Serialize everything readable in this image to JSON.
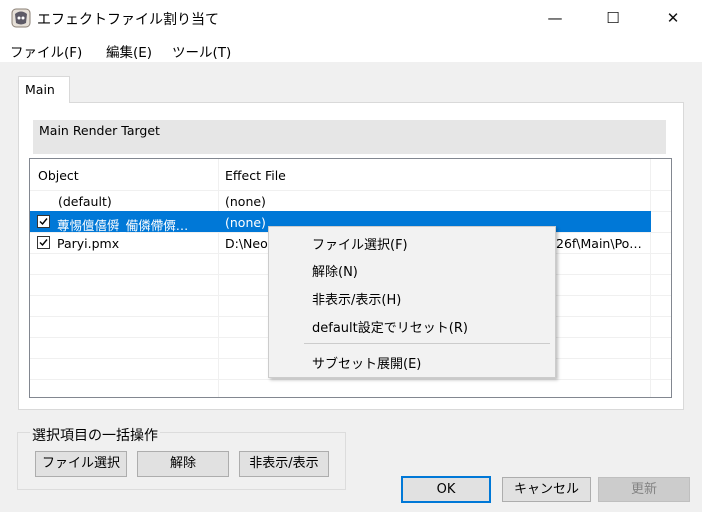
{
  "window": {
    "title": "エフェクトファイル割り当て",
    "minimize_glyph": "—",
    "maximize_glyph": "☐",
    "close_glyph": "✕"
  },
  "menu": [
    "ファイル(F)",
    "編集(E)",
    "ツール(T)"
  ],
  "tabs": [
    {
      "label": "Main",
      "selected": true
    }
  ],
  "render_target": "Main Render Target",
  "list": {
    "columns": [
      "Object",
      "Effect File"
    ],
    "rows": [
      {
        "checkbox": false,
        "object": "(default)",
        "effect": "(none)",
        "selected": false
      },
      {
        "checkbox": true,
        "object": "蓴惕儃僖僢_僃僯僀僲…",
        "effect": "(none)",
        "selected": true
      },
      {
        "checkbox": true,
        "object": "Paryi.pmx",
        "effect": "D:\\Neo",
        "effect_tail": "26f\\Main\\Po…",
        "selected": false
      }
    ]
  },
  "context_menu": {
    "items": [
      "ファイル選択(F)",
      "解除(N)",
      "非表示/表示(H)",
      "default設定でリセット(R)"
    ],
    "after_separator": [
      "サブセット展開(E)"
    ]
  },
  "batch_group": {
    "title": "選択項目の一括操作",
    "buttons": [
      "ファイル選択",
      "解除",
      "非表示/表示"
    ]
  },
  "dialog_buttons": {
    "ok": "OK",
    "cancel": "キャンセル",
    "update": "更新",
    "update_enabled": false
  },
  "colors": {
    "selection": "#0078d7",
    "client_bg": "#f0f0f0",
    "menu_bg": "#f2f2f2"
  }
}
